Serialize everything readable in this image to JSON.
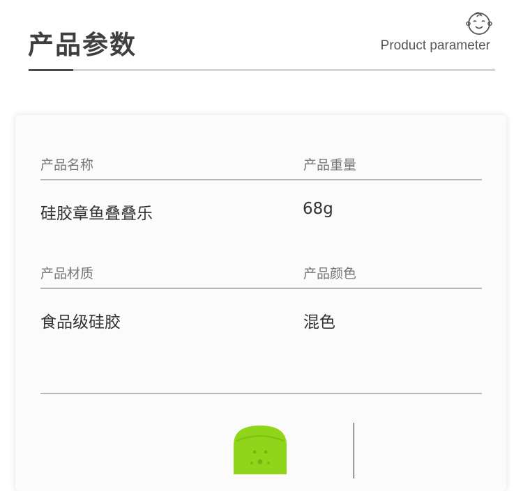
{
  "header": {
    "title": "产品参数",
    "subtitle": "Product parameter",
    "icon": "baby-face-icon"
  },
  "params": {
    "name_label": "产品名称",
    "name_value": "硅胶章鱼叠叠乐",
    "weight_label": "产品重量",
    "weight_value": "68g",
    "material_label": "产品材质",
    "material_value": "食品级硅胶",
    "color_label": "产品颜色",
    "color_value": "混色"
  },
  "colors": {
    "toy_green": "#8fd61a",
    "title_text": "#3f3f3f"
  }
}
